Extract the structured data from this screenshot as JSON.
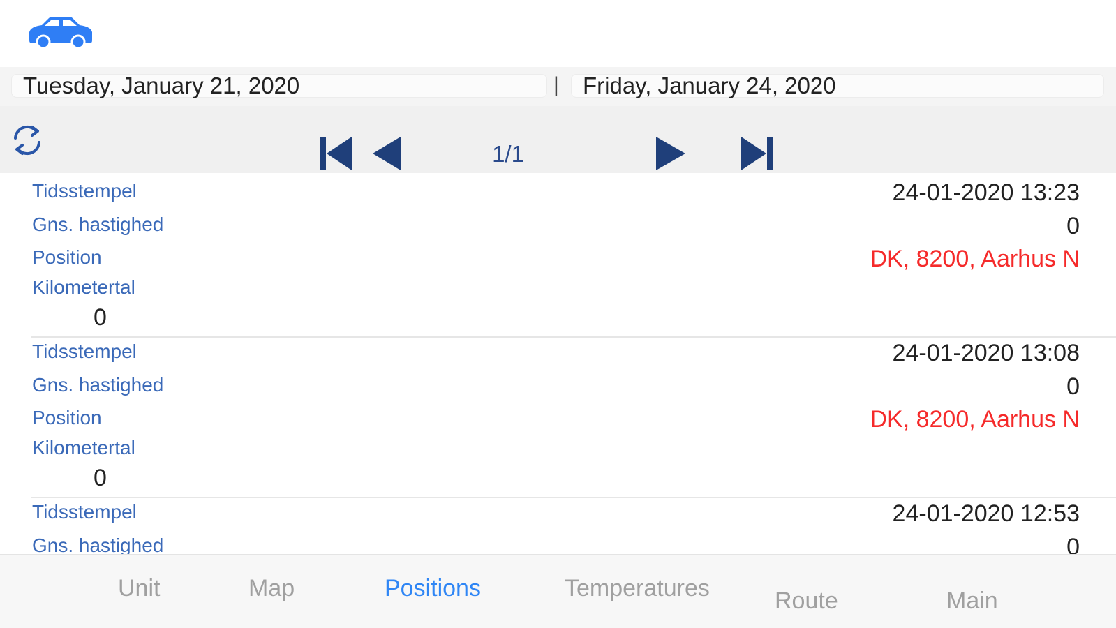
{
  "header": {
    "icon": "car-icon",
    "accent_color": "#2f7ef5"
  },
  "date_range": {
    "from": "Tuesday, January 21, 2020",
    "separator": "|",
    "to": "Friday, January 24, 2020"
  },
  "toolbar": {
    "refresh_icon": "refresh-icon",
    "first_icon": "skip-first-icon",
    "prev_icon": "previous-icon",
    "next_icon": "next-icon",
    "last_icon": "skip-last-icon",
    "page": "1/1",
    "nav_color": "#1f3f7a"
  },
  "records": [
    {
      "timestamp_label": "Tidsstempel",
      "timestamp": "24-01-2020 13:23",
      "speed_label": "Gns. hastighed",
      "speed": "0",
      "position_label": "Position",
      "position": "DK, 8200, Aarhus N",
      "odometer_label": "Kilometertal",
      "odometer": "0"
    },
    {
      "timestamp_label": "Tidsstempel",
      "timestamp": "24-01-2020 13:08",
      "speed_label": "Gns. hastighed",
      "speed": "0",
      "position_label": "Position",
      "position": "DK, 8200, Aarhus N",
      "odometer_label": "Kilometertal",
      "odometer": "0"
    },
    {
      "timestamp_label": "Tidsstempel",
      "timestamp": "24-01-2020 12:53",
      "speed_label": "Gns. hastighed",
      "speed": "0"
    }
  ],
  "tabs": [
    {
      "label": "Unit",
      "active": false
    },
    {
      "label": "Map",
      "active": false
    },
    {
      "label": "Positions",
      "active": true
    },
    {
      "label": "Temperatures",
      "active": false
    },
    {
      "label": "Route",
      "active": false
    },
    {
      "label": "Main",
      "active": false
    }
  ],
  "colors": {
    "label_blue": "#3a69b8",
    "position_red": "#f52a2a",
    "active_tab": "#2f86f5",
    "inactive_tab": "#a0a0a0"
  }
}
